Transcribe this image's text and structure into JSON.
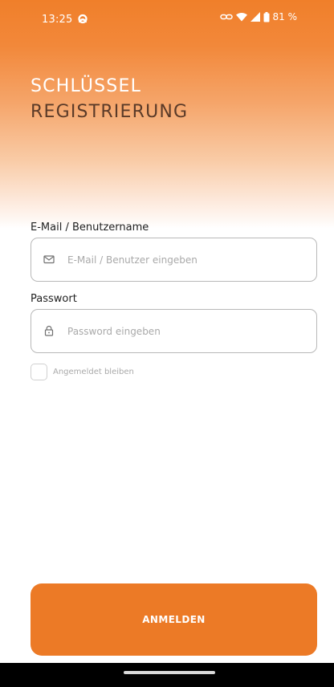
{
  "status_bar": {
    "time": "13:25",
    "battery": "81 %",
    "icons": [
      "app-notification-icon",
      "link-icon",
      "wifi-icon",
      "signal-icon",
      "battery-icon"
    ]
  },
  "header": {
    "title_line1": "SCHLÜSSEL",
    "title_line2": "REGISTRIERUNG"
  },
  "form": {
    "email_label": "E-Mail / Benutzername",
    "email_placeholder": "E-Mail / Benutzer eingeben",
    "email_icon": "mail-icon",
    "password_label": "Passwort",
    "password_placeholder": "Password eingeben",
    "password_icon": "lock-icon",
    "remember_label": "Angemeldet bleiben",
    "remember_checked": false
  },
  "actions": {
    "login_label": "ANMELDEN"
  },
  "colors": {
    "accent": "#ec7a26",
    "title_dark": "#5a3a28"
  }
}
